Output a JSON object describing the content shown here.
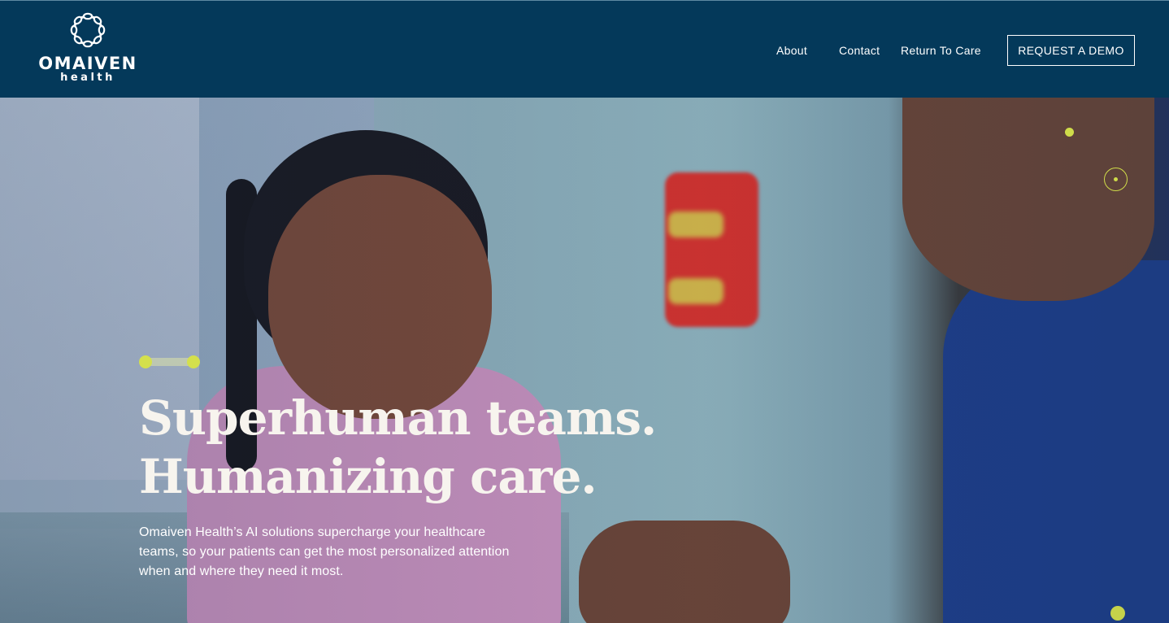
{
  "brand": {
    "name": "OMAIVEN",
    "sub": "health",
    "logo_icon": "omaiven-ring-logo"
  },
  "nav": {
    "links": [
      "About",
      "Contact",
      "Return To Care"
    ],
    "cta": "REQUEST A DEMO"
  },
  "hero": {
    "headline_line1": "Superhuman teams.",
    "headline_line2": "Humanizing care.",
    "body": "Omaiven Health’s AI solutions supercharge your healthcare teams, so your patients can get the most personalized attention when and where they need it most.",
    "image": "child-and-doctor-photo",
    "slider_dots": 2
  },
  "colors": {
    "header_bg": "#04395a",
    "accent": "#d4e04c",
    "text": "#ffffff"
  }
}
